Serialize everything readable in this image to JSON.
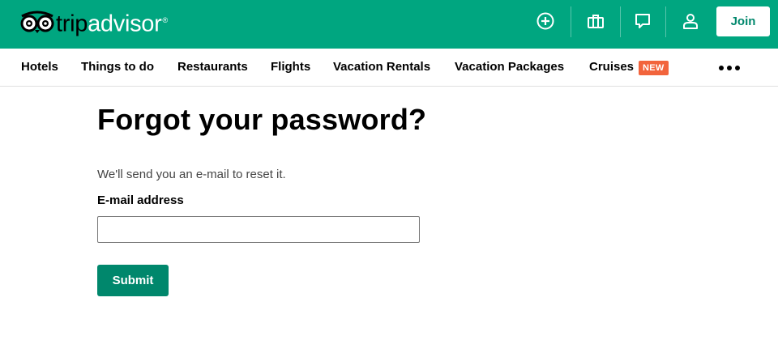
{
  "brand": {
    "name_part1": "trip",
    "name_part2": "advisor",
    "registered": "®",
    "color": "#00a680"
  },
  "header": {
    "icons": [
      "plus-circle-icon",
      "briefcase-icon",
      "speech-bubble-icon",
      "user-icon"
    ],
    "join_label": "Join"
  },
  "nav": {
    "items": [
      "Hotels",
      "Things to do",
      "Restaurants",
      "Flights",
      "Vacation Rentals",
      "Vacation Packages",
      "Cruises"
    ],
    "badge": "NEW",
    "badge_color": "#f2643c",
    "more_icon": "more-dots-icon"
  },
  "main": {
    "title": "Forgot your password?",
    "helper_text": "We'll send you an e-mail to reset it.",
    "email_label": "E-mail address",
    "email_value": "",
    "submit_label": "Submit",
    "submit_color": "#00876c"
  }
}
